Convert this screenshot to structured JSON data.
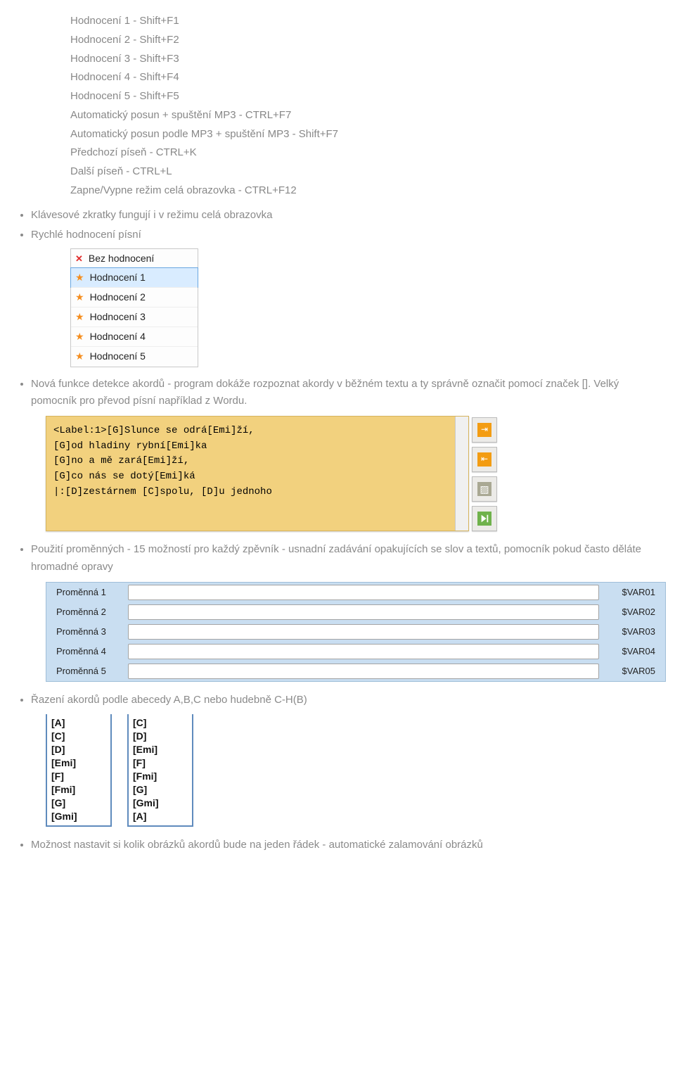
{
  "shortcuts": [
    "Hodnocení 1 - Shift+F1",
    "Hodnocení 2 - Shift+F2",
    "Hodnocení 3 - Shift+F3",
    "Hodnocení 4 - Shift+F4",
    "Hodnocení 5 - Shift+F5",
    "Automatický posun + spuštění MP3 - CTRL+F7",
    "Automatický posun podle MP3 + spuštění MP3 - Shift+F7",
    "Předchozí píseň - CTRL+K",
    "Další píseň - CTRL+L",
    "Zapne/Vypne režim celá obrazovka - CTRL+F12"
  ],
  "bullet1": "Klávesové zkratky fungují i v režimu celá obrazovka",
  "bullet2": "Rychlé hodnocení písní",
  "rating_items": [
    {
      "icon": "x",
      "label": "Bez hodnocení"
    },
    {
      "icon": "star",
      "label": "Hodnocení 1",
      "selected": true
    },
    {
      "icon": "star",
      "label": "Hodnocení 2"
    },
    {
      "icon": "star",
      "label": "Hodnocení 3"
    },
    {
      "icon": "star",
      "label": "Hodnocení 4"
    },
    {
      "icon": "star",
      "label": "Hodnocení 5"
    }
  ],
  "bullet3": "Nová funkce detekce akordů - program dokáže rozpoznat akordy v běžném textu a ty správně označit pomocí značek []. Velký pomocník pro převod písní například z Wordu.",
  "editor_lines": [
    "<Label:1>[G]Slunce se odrá[Emi]ží,",
    "[G]od hladiny rybní[Emi]ka",
    "[G]no a mě zará[Emi]ží,",
    "[G]co nás se dotý[Emi]ká",
    "|:[D]zestárnem [C]spolu, [D]u jednoho"
  ],
  "bullet4": "Použití proměnných - 15 možností pro každý zpěvník - usnadní zadávání opakujících se slov a textů, pomocník pokud často děláte hromadné opravy",
  "variables": [
    {
      "label": "Proměnná 1",
      "code": "$VAR01"
    },
    {
      "label": "Proměnná 2",
      "code": "$VAR02"
    },
    {
      "label": "Proměnná 3",
      "code": "$VAR03"
    },
    {
      "label": "Proměnná 4",
      "code": "$VAR04"
    },
    {
      "label": "Proměnná 5",
      "code": "$VAR05"
    }
  ],
  "bullet5": "Řazení akordů podle abecedy A,B,C nebo hudebně C-H(B)",
  "chord_left": [
    "[A]",
    "[C]",
    "[D]",
    "[Emi]",
    "[F]",
    "[Fmi]",
    "[G]",
    "[Gmi]"
  ],
  "chord_right": [
    "[C]",
    "[D]",
    "[Emi]",
    "[F]",
    "[Fmi]",
    "[G]",
    "[Gmi]",
    "[A]"
  ],
  "bullet6": "Možnost nastavit si kolik obrázků akordů bude na jeden řádek - automatické zalamování obrázků"
}
